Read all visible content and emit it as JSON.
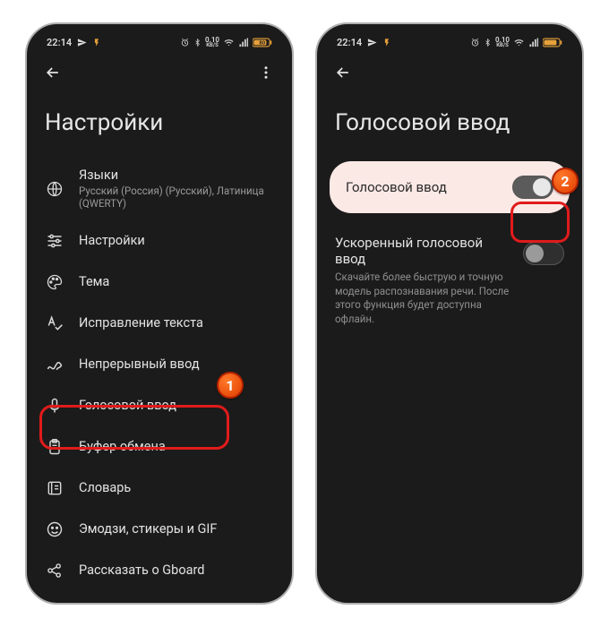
{
  "status": {
    "time": "22:14",
    "net_speed": "0.10",
    "net_unit": "KB/S",
    "battery": "80"
  },
  "screen_left": {
    "title": "Настройки",
    "items": [
      {
        "icon": "globe-icon",
        "label": "Языки",
        "sub": "Русский (Россия) (Русский), Латиница (QWERTY)"
      },
      {
        "icon": "sliders-icon",
        "label": "Настройки"
      },
      {
        "icon": "palette-icon",
        "label": "Тема"
      },
      {
        "icon": "spellcheck-icon",
        "label": "Исправление текста"
      },
      {
        "icon": "gesture-icon",
        "label": "Непрерывный ввод"
      },
      {
        "icon": "mic-icon",
        "label": "Голосовой ввод"
      },
      {
        "icon": "clipboard-icon",
        "label": "Буфер обмена"
      },
      {
        "icon": "dictionary-icon",
        "label": "Словарь"
      },
      {
        "icon": "emoji-icon",
        "label": "Эмодзи, стикеры и GIF"
      },
      {
        "icon": "share-icon",
        "label": "Рассказать о Gboard"
      }
    ]
  },
  "screen_right": {
    "title": "Голосовой ввод",
    "main_toggle": {
      "label": "Голосовой ввод",
      "state": "on"
    },
    "fast": {
      "title": "Ускоренный голосовой ввод",
      "desc": "Скачайте более быструю и точную модель распознавания речи. После этого функция будет доступна офлайн.",
      "state": "off"
    }
  },
  "callouts": {
    "one": "1",
    "two": "2"
  }
}
